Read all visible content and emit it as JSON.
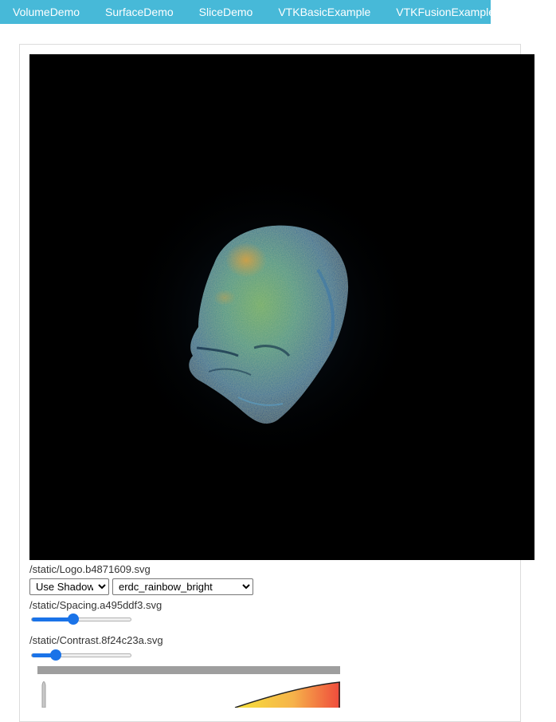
{
  "nav": {
    "items": [
      {
        "label": "VolumeDemo"
      },
      {
        "label": "SurfaceDemo"
      },
      {
        "label": "SliceDemo"
      },
      {
        "label": "VTKBasicExample"
      },
      {
        "label": "VTKFusionExample"
      }
    ]
  },
  "controls": {
    "logo_text": "/static/Logo.b4871609.svg",
    "shadow_select": {
      "value": "Use Shadow",
      "options": [
        "Use Shadow"
      ]
    },
    "colormap_select": {
      "value": "erdc_rainbow_bright",
      "options": [
        "erdc_rainbow_bright"
      ]
    },
    "spacing_text": "/static/Spacing.a495ddf3.svg",
    "spacing_value": 0.42,
    "contrast_text": "/static/Contrast.8f24c23a.svg",
    "contrast_value": 0.24
  },
  "colors": {
    "nav_bg": "#47b9d8",
    "slider_accent": "#1a73e8",
    "viewer_bg": "#000000"
  }
}
